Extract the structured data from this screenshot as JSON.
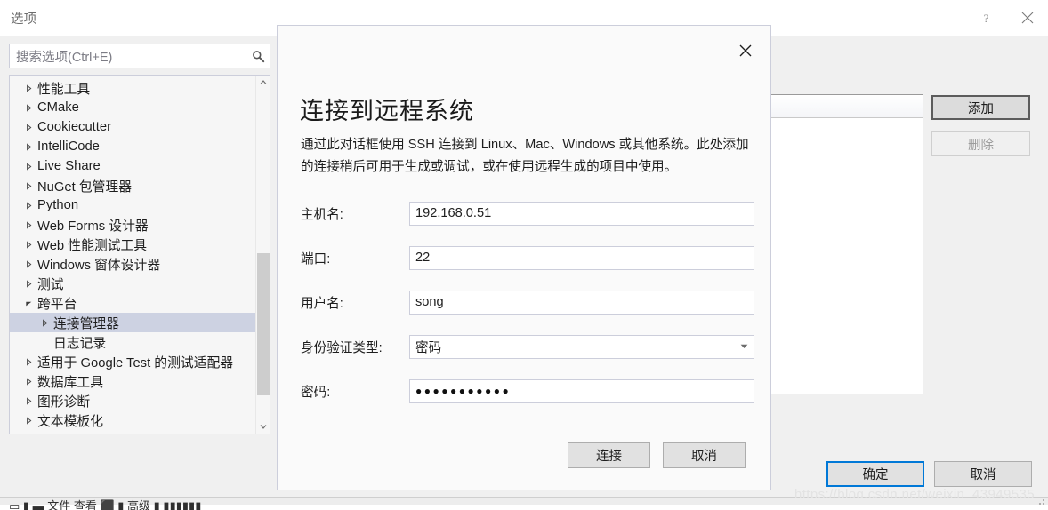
{
  "window": {
    "title": "选项",
    "help_icon": "question-mark-icon",
    "close_icon": "close-icon"
  },
  "search": {
    "placeholder": "搜索选项(Ctrl+E)",
    "value": "搜索选项(Ctrl+E)",
    "icon": "search-icon"
  },
  "tree": {
    "items": [
      {
        "label": "性能工具",
        "level": 1,
        "expander": "collapsed",
        "selected": false
      },
      {
        "label": "CMake",
        "level": 1,
        "expander": "collapsed",
        "selected": false
      },
      {
        "label": "Cookiecutter",
        "level": 1,
        "expander": "collapsed",
        "selected": false
      },
      {
        "label": "IntelliCode",
        "level": 1,
        "expander": "collapsed",
        "selected": false
      },
      {
        "label": "Live Share",
        "level": 1,
        "expander": "collapsed",
        "selected": false
      },
      {
        "label": "NuGet 包管理器",
        "level": 1,
        "expander": "collapsed",
        "selected": false
      },
      {
        "label": "Python",
        "level": 1,
        "expander": "collapsed",
        "selected": false
      },
      {
        "label": "Web Forms 设计器",
        "level": 1,
        "expander": "collapsed",
        "selected": false
      },
      {
        "label": "Web 性能测试工具",
        "level": 1,
        "expander": "collapsed",
        "selected": false
      },
      {
        "label": "Windows 窗体设计器",
        "level": 1,
        "expander": "collapsed",
        "selected": false
      },
      {
        "label": "测试",
        "level": 1,
        "expander": "collapsed",
        "selected": false
      },
      {
        "label": "跨平台",
        "level": 1,
        "expander": "expanded",
        "selected": false
      },
      {
        "label": "连接管理器",
        "level": 2,
        "expander": "collapsed",
        "selected": true
      },
      {
        "label": "日志记录",
        "level": 2,
        "expander": "none",
        "selected": false
      },
      {
        "label": "适用于 Google Test 的测试适配器",
        "level": 1,
        "expander": "collapsed",
        "selected": false
      },
      {
        "label": "数据库工具",
        "level": 1,
        "expander": "collapsed",
        "selected": false
      },
      {
        "label": "图形诊断",
        "level": 1,
        "expander": "collapsed",
        "selected": false
      },
      {
        "label": "文本模板化",
        "level": 1,
        "expander": "collapsed",
        "selected": false
      }
    ],
    "selected_color": "#cdd2e2"
  },
  "side_buttons": {
    "add": "添加",
    "remove": "删除"
  },
  "main_buttons": {
    "ok": "确定",
    "cancel": "取消",
    "ok_focus_color": "#0078d7"
  },
  "dialog": {
    "title": "连接到远程系统",
    "close_icon": "close-icon",
    "description": "通过此对话框使用 SSH 连接到 Linux、Mac、Windows 或其他系统。此处添加的连接稍后可用于生成或调试，或在使用远程生成的项目中使用。",
    "fields": [
      {
        "label": "主机名:",
        "value": "192.168.0.51",
        "type": "text"
      },
      {
        "label": "端口:",
        "value": "22",
        "type": "text"
      },
      {
        "label": "用户名:",
        "value": "song",
        "type": "text"
      },
      {
        "label": "身份验证类型:",
        "value": "密码",
        "type": "select"
      },
      {
        "label": "密码:",
        "value": "●●●●●●●●●●●",
        "type": "password"
      }
    ],
    "buttons": {
      "connect": "连接",
      "cancel": "取消"
    }
  },
  "watermark": {
    "text": "https://blog.csdn.net/weixin_43949535"
  },
  "bottom": {
    "glyphs": "▭ ▮ ▬ 文件  查看  ⬛ ▮ 高级  ▮ ▮▮▮▮▮▮"
  }
}
